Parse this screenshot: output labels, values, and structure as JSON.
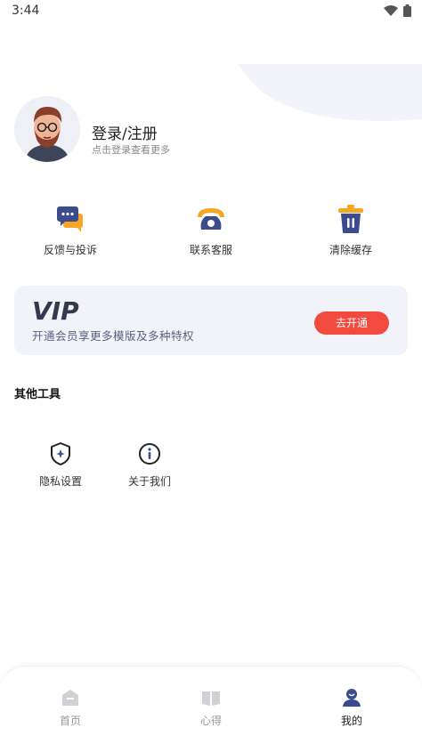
{
  "status_bar": {
    "time": "3:44"
  },
  "profile": {
    "title": "登录/注册",
    "subtitle": "点击登录查看更多"
  },
  "quick_actions": [
    {
      "label": "反馈与投诉",
      "icon": "chat-bubble-icon"
    },
    {
      "label": "联系客服",
      "icon": "telephone-icon"
    },
    {
      "label": "清除缓存",
      "icon": "trash-icon"
    }
  ],
  "vip": {
    "logo": "VIP",
    "description": "开通会员享更多模版及多种特权",
    "button": "去开通"
  },
  "other_tools": {
    "title": "其他工具",
    "items": [
      {
        "label": "隐私设置",
        "icon": "shield-icon"
      },
      {
        "label": "关于我们",
        "icon": "info-icon"
      }
    ]
  },
  "tabbar": {
    "items": [
      {
        "label": "首页",
        "icon": "home-icon",
        "active": false
      },
      {
        "label": "心得",
        "icon": "book-icon",
        "active": false
      },
      {
        "label": "我的",
        "icon": "user-icon",
        "active": true
      }
    ]
  },
  "colors": {
    "accent": "#3c4b8c",
    "vip_button": "#f24a3f",
    "highlight": "#f5a623"
  }
}
